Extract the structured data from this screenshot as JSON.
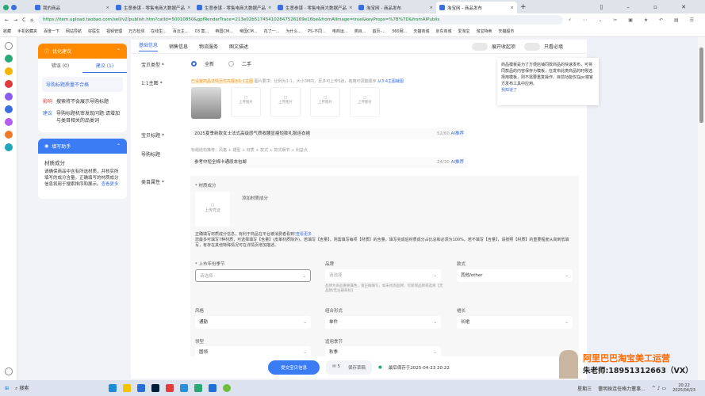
{
  "browser": {
    "tabs": [
      {
        "label": "我的商品"
      },
      {
        "label": "生意参谋 - 零售电商大数据产品"
      },
      {
        "label": "生意参谋 - 零售电商大数据产品"
      },
      {
        "label": "生意参谋 - 零售电商大数据产品"
      },
      {
        "label": "淘宝网 - 商品发布"
      },
      {
        "label": "淘宝网 - 商品发布"
      }
    ],
    "url": "https://item.upload.taobao.com/sell/v2/publish.htm?catId=50010850&gpfRenderTrace=213e02b5174541028475261​69e16be&fromAIImage=true&keyProps=%7B%7D&fromAIPublis",
    "bookmarks": [
      "收藏",
      "手机收藏夹",
      "百度一下",
      "网站导航",
      "好医生",
      "视频管理",
      "万方检测",
      "在线生...",
      "百云主...",
      "03 案...",
      "帝国CM...",
      "帝国CM...",
      "花了一...",
      "为什么...",
      "PS-不同...",
      "电商运...",
      "类目...",
      "首页-...",
      "360网...",
      "天猫商城",
      "京东商城",
      "爱淘宝",
      "淘宝特卖",
      "天猫超市"
    ]
  },
  "left": {
    "optimize": {
      "title": "优化建议",
      "tabs": [
        "错误 (0)",
        "建议 (1)"
      ],
      "issue": "导购标题质量不合格",
      "impact_label": "影响",
      "impact": "搜索将不会展示导购标题",
      "advice_label": "建议",
      "advice": "导购标题机审发现问题:请增加与类目相关的品类词"
    },
    "helper": {
      "title": "填写助手",
      "subtitle": "材质成分",
      "text": "请确保商品中含有所选材质，并核实所填写的成分含量。正确填写的材质成分信息将用于搜索排序和展示。",
      "more": "查看更多"
    }
  },
  "main": {
    "tabs": [
      "基础信息",
      "销售信息",
      "物流服务",
      "图文描述"
    ],
    "toggles": [
      "展开收起项",
      "只看必填"
    ],
    "type": {
      "label": "宝贝类型",
      "options": [
        "全新",
        "二手"
      ],
      "selected": "全新"
    },
    "image": {
      "label": "1:1主图",
      "notice": "已设置商品详情页优先展示1:1主图",
      "req": "图片要求：比例为1:1，大小3M内，至多可上传5张，拖拽可调整顺序",
      "crop": "从3:4主图裁图",
      "upload": "上传图片"
    },
    "title": {
      "label": "宝贝标题",
      "value": "2025夏季新款女士法式高级感气质收腰显瘦短款礼服连衣裙",
      "count": "52/60",
      "ai": "AI推荐"
    },
    "guide": {
      "label": "导购标题",
      "hint": "标题结构推荐：风格 + 裙型 + 材质 + 款式 + 款式细节 + 利益点",
      "value": "参考中短全棉卡通原本包邮",
      "count": "24/30",
      "ai": "AI推荐"
    },
    "attrs": {
      "label": "类目属性",
      "material": "材质成分",
      "upload_proof": "上传凭证",
      "add_material": "添加材质成分",
      "note1": "正确填写材质成分信息，有利于商品在平台被消费者看到!",
      "note1_link": "查看更多",
      "note2": "您最多可填写7种材质，可选择填写【含量】(皮革材质除外)。若填写【含量】，则需填写每项【材质】的含量，填写完成后材质成分占比总和必须为100%。若不填写【含量】，请按照【材质】的重要程度从高到低填写，有存在其他特殊情况可在详情页增加描述。",
      "fields": [
        {
          "label": "上市年份季节",
          "value": "请选择",
          "placeholder": true
        },
        {
          "label": "品牌",
          "value": "请选择",
          "placeholder": true
        },
        {
          "label": "款式",
          "value": "其他/other"
        },
        {
          "label": "风格",
          "value": "通勤"
        },
        {
          "label": "组合形式",
          "value": "单件"
        },
        {
          "label": "裙长",
          "value": "长裙"
        },
        {
          "label": "领型",
          "value": "圆领"
        },
        {
          "label": "适用季节",
          "value": "秋季"
        }
      ],
      "brand_hint": "品牌为商品重要属性，请正确填写，如未找到品牌，可新增品牌或选择【无品牌/无注册商标】"
    }
  },
  "tooltip": {
    "text": "商品模板是为了方便店铺同款商品的快速发布，可将同款品的内容保存为模板，在发布此类商品的时候选择用模板，则不需要重复操作。目前功能仅在pc端官方发布工具中应用。",
    "ok": "我知道了"
  },
  "bottom": {
    "submit": "提交宝贝信息",
    "count": "5",
    "draft": "保存草稿",
    "saved": "最后保存于2025-04-23 20:22"
  },
  "watermark": {
    "line1": "阿里巴巴淘宝美工运营",
    "line2": "朱老师:18951312663（VX）"
  },
  "taskbar": {
    "search": "搜索",
    "day": "星期三",
    "news": "蕾明珠连任格力董事...",
    "time": "20:22",
    "date": "2025/04/23"
  }
}
